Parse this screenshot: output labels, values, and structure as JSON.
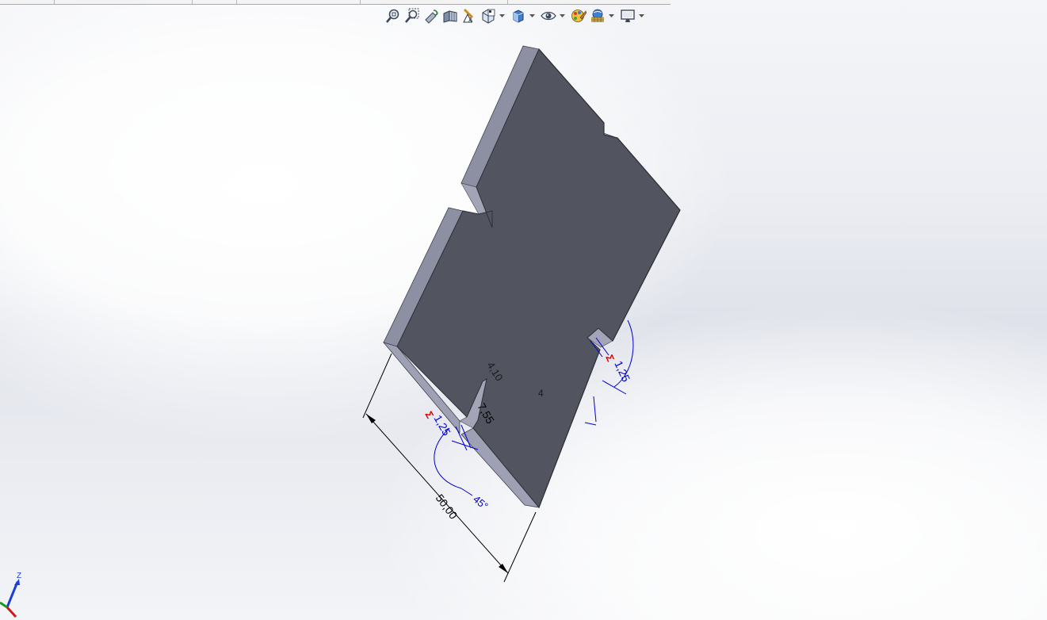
{
  "heads_up_toolbar": {
    "buttons": [
      {
        "name": "zoom-to-fit-icon"
      },
      {
        "name": "zoom-to-area-icon"
      },
      {
        "name": "previous-view-icon"
      },
      {
        "name": "section-view-icon"
      },
      {
        "name": "dynamic-annotation-views-icon"
      },
      {
        "name": "view-orientation-icon",
        "dropdown": true
      },
      {
        "name": "display-style-icon",
        "dropdown": true
      },
      {
        "name": "hide-show-items-icon",
        "dropdown": true
      },
      {
        "name": "edit-appearance-icon"
      },
      {
        "name": "apply-scene-icon",
        "dropdown": true
      },
      {
        "name": "view-settings-icon",
        "dropdown": true
      }
    ]
  },
  "model": {
    "part_color": "#525460",
    "edge_color": "#9a9cb0",
    "dimension_color": "#000000",
    "sketch_dimension_color": "#0000cc",
    "relation_color": "#e00000",
    "dimensions": {
      "length": "50,00",
      "slot_width_left": "1,25",
      "slot_width_right": "1,25",
      "slot_depth": "7,55",
      "edge_offset": "4,10",
      "feature_number": "4",
      "angle": "45°"
    },
    "relation_symbols": {
      "left": "Σ",
      "right": "Σ"
    }
  },
  "triad": {
    "z_label": "Z",
    "z_color": "#1a3fd9",
    "y_color": "#1a9a1a",
    "x_color": "#cc1a1a"
  }
}
